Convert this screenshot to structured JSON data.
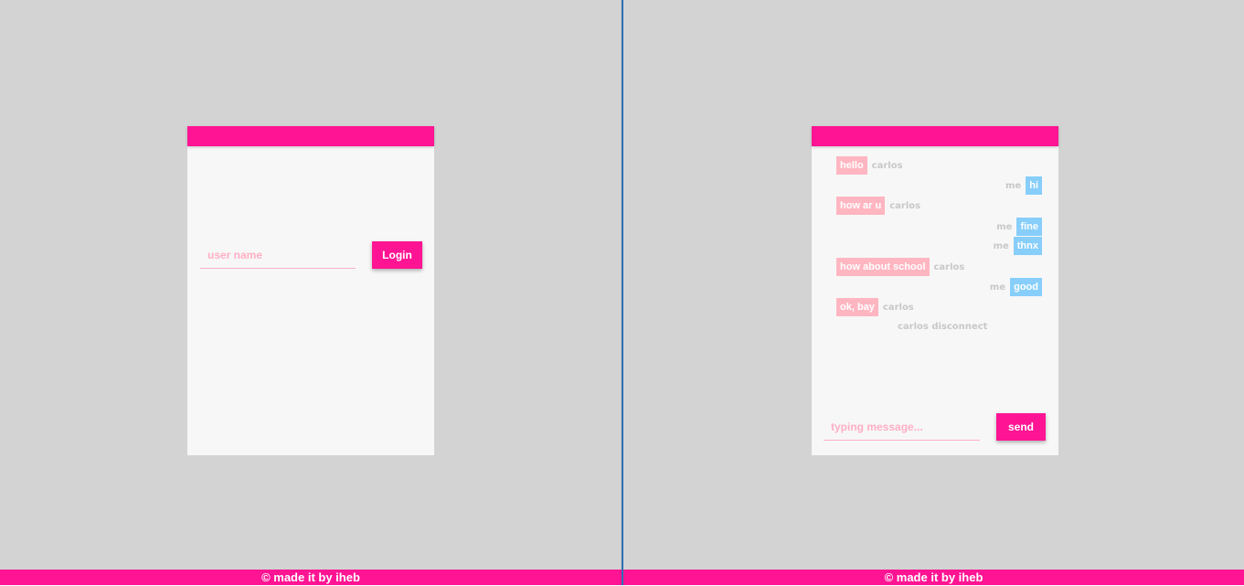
{
  "login": {
    "username_placeholder": "user name",
    "login_label": "Login"
  },
  "chat": {
    "messages": [
      {
        "direction": "incoming",
        "text": "hello",
        "sender": "carlos"
      },
      {
        "direction": "outgoing",
        "text": "hi",
        "sender": "me"
      },
      {
        "direction": "incoming",
        "text": "how ar u",
        "sender": "carlos"
      },
      {
        "direction": "outgoing",
        "text": "fine",
        "sender": "me"
      },
      {
        "direction": "outgoing",
        "text": "thnx",
        "sender": "me"
      },
      {
        "direction": "incoming",
        "text": "how about school",
        "sender": "carlos"
      },
      {
        "direction": "outgoing",
        "text": "good",
        "sender": "me"
      },
      {
        "direction": "incoming",
        "text": "ok, bay",
        "sender": "carlos"
      }
    ],
    "disconnect_notice": "carlos disconnect",
    "message_placeholder": "typing message...",
    "send_label": "send"
  },
  "footer": {
    "left_text": "© made it by iheb",
    "right_text": "© made it by iheb"
  },
  "colors": {
    "accent": "#ff1493",
    "incoming_bubble": "#ffb6c1",
    "outgoing_bubble": "#87cefa",
    "background": "#d3d3d3",
    "card": "#f7f7f7",
    "divider": "#2f6db0"
  }
}
